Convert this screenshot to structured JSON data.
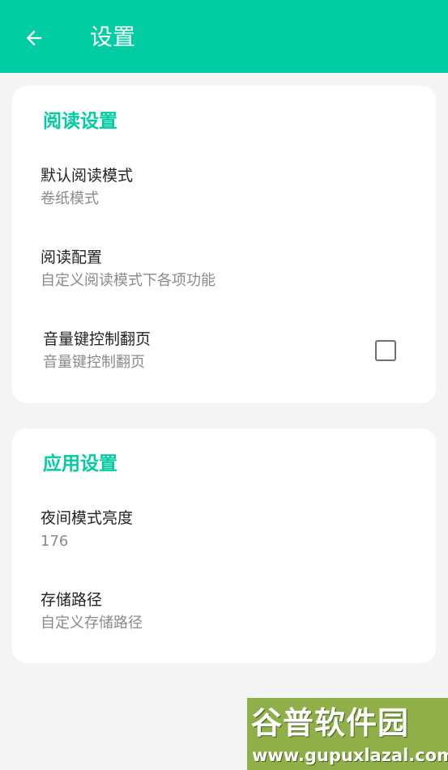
{
  "appbar": {
    "title": "设置",
    "back_icon": "arrow-left-icon",
    "color": "#00cca3"
  },
  "reading_section": {
    "header": "阅读设置",
    "items": [
      {
        "title": "默认阅读模式",
        "summary": "卷纸模式"
      },
      {
        "title": "阅读配置",
        "summary": "自定义阅读模式下各项功能"
      },
      {
        "title": "音量键控制翻页",
        "summary": "音量键控制翻页",
        "checked": false
      }
    ]
  },
  "app_section": {
    "header": "应用设置",
    "items": [
      {
        "title": "夜间模式亮度",
        "summary": "176"
      },
      {
        "title": "存储路径",
        "summary": "自定义存储路径"
      }
    ]
  },
  "watermark": {
    "title": "谷普软件园",
    "url": "www.gupuxlazal.com"
  }
}
